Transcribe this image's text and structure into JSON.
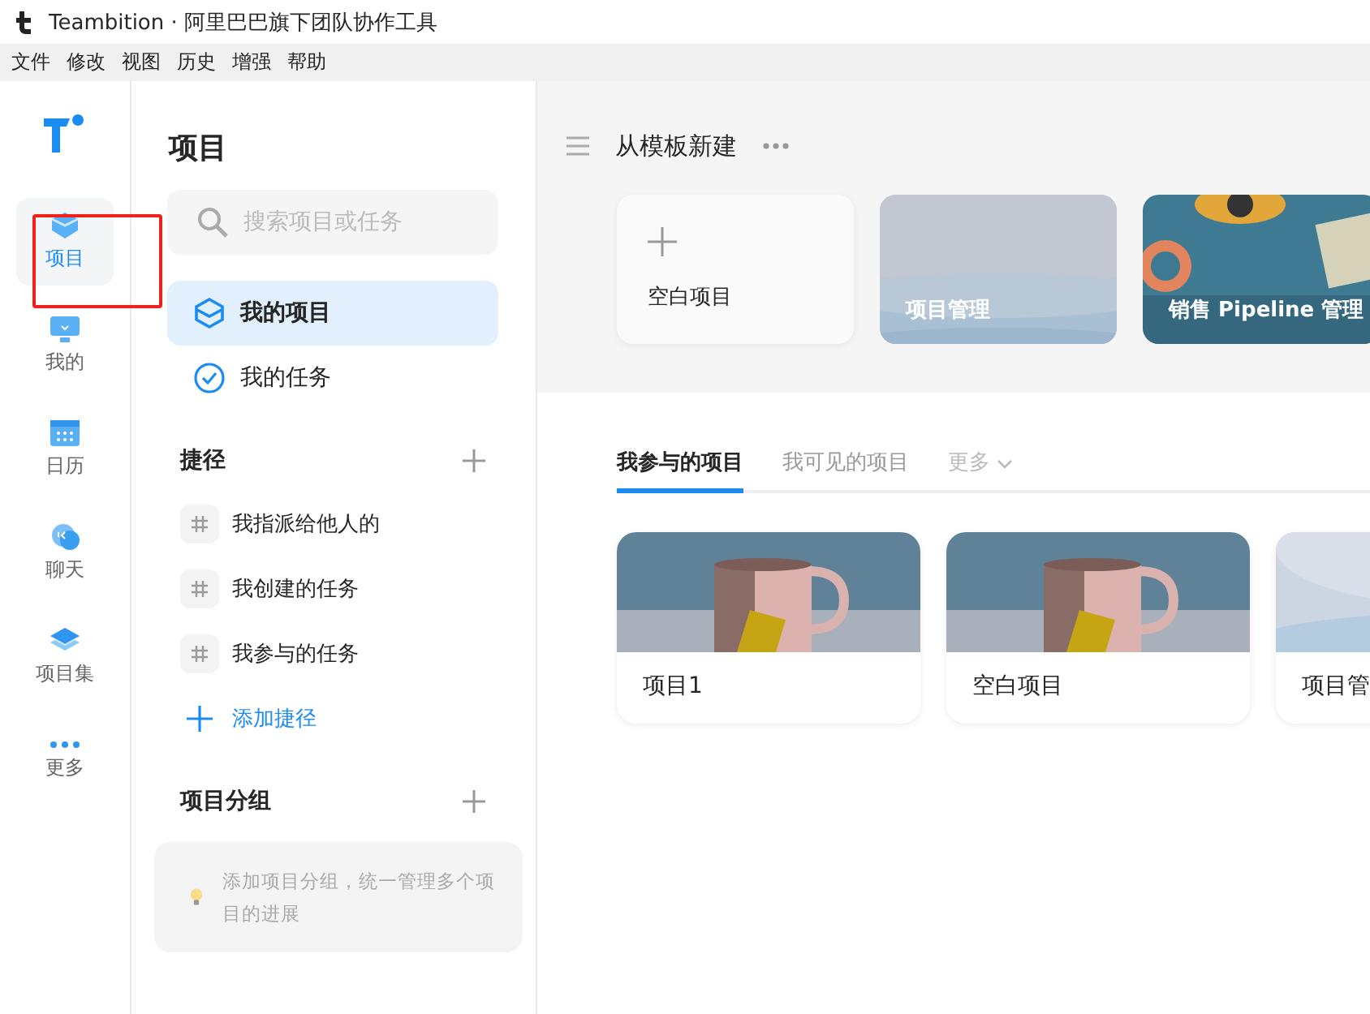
{
  "window": {
    "title": "Teambition · 阿里巴巴旗下团队协作工具"
  },
  "menu": [
    "文件",
    "修改",
    "视图",
    "历史",
    "增强",
    "帮助"
  ],
  "rail": {
    "items": [
      {
        "label": "项目",
        "selected": true,
        "annotated": true
      },
      {
        "label": "我的",
        "selected": false,
        "annotated": false
      },
      {
        "label": "日历",
        "selected": false,
        "annotated": false
      },
      {
        "label": "聊天",
        "selected": false,
        "annotated": false
      },
      {
        "label": "项目集",
        "selected": false,
        "annotated": false
      },
      {
        "label": "更多",
        "selected": false,
        "annotated": false
      }
    ]
  },
  "sidebar": {
    "title": "项目",
    "search": {
      "placeholder": "搜索项目或任务"
    },
    "nav": [
      {
        "label": "我的项目",
        "selected": true
      },
      {
        "label": "我的任务",
        "selected": false
      }
    ],
    "shortcuts": {
      "title": "捷径",
      "items": [
        "我指派给他人的",
        "我创建的任务",
        "我参与的任务"
      ],
      "add_label": "添加捷径"
    },
    "groups": {
      "title": "项目分组",
      "tip": "添加项目分组，统一管理多个项目的进展"
    }
  },
  "main": {
    "templates": {
      "title": "从模板新建",
      "cards": [
        {
          "label": "空白项目",
          "kind": "blank"
        },
        {
          "label": "项目管理",
          "kind": "picture"
        },
        {
          "label": "销售 Pipeline 管理",
          "kind": "picture"
        }
      ]
    },
    "tabs": [
      {
        "label": "我参与的项目",
        "selected": true,
        "kind": "tab"
      },
      {
        "label": "我可见的项目",
        "selected": false,
        "kind": "tab"
      },
      {
        "label": "更多",
        "selected": false,
        "kind": "dropdown"
      }
    ],
    "projects": [
      {
        "label": "项目1"
      },
      {
        "label": "空白项目"
      },
      {
        "label": "项目管"
      }
    ]
  }
}
